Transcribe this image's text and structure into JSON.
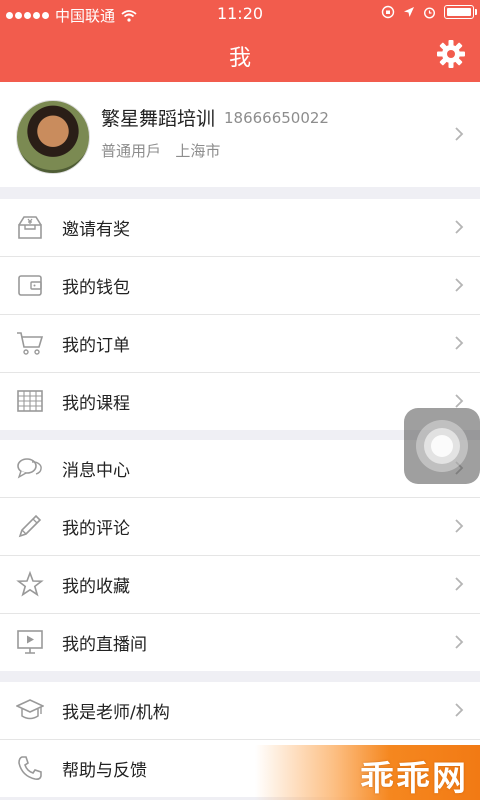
{
  "status_bar": {
    "carrier": "中国联通",
    "time": "11:20"
  },
  "header": {
    "title": "我",
    "settings_icon": "gear-icon"
  },
  "profile": {
    "name": "繁星舞蹈培训",
    "phone": "18666650022",
    "user_type": "普通用戶",
    "city": "上海市"
  },
  "menu_groups": [
    [
      {
        "label": "邀请有奖",
        "icon": "gift-inbox-icon"
      },
      {
        "label": "我的钱包",
        "icon": "wallet-icon"
      },
      {
        "label": "我的订单",
        "icon": "cart-icon"
      },
      {
        "label": "我的课程",
        "icon": "calendar-grid-icon"
      }
    ],
    [
      {
        "label": "消息中心",
        "icon": "chat-bubbles-icon"
      },
      {
        "label": "我的评论",
        "icon": "pencil-icon"
      },
      {
        "label": "我的收藏",
        "icon": "star-icon"
      },
      {
        "label": "我的直播间",
        "icon": "video-play-icon"
      }
    ],
    [
      {
        "label": "我是老师/机构",
        "icon": "graduation-cap-icon"
      },
      {
        "label": "帮助与反馈",
        "icon": "phone-icon"
      }
    ]
  ],
  "watermark": {
    "text": "乖乖网"
  },
  "colors": {
    "brand": "#f25c4d",
    "background": "#efeff4",
    "watermark_orange": "#f5871f"
  }
}
